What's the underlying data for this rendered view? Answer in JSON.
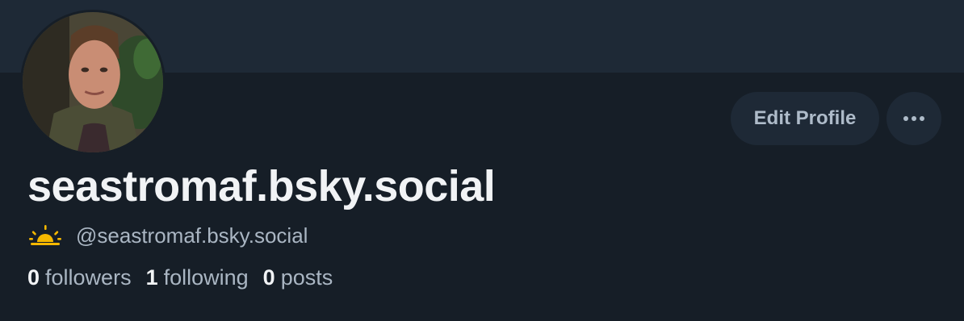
{
  "profile": {
    "display_name": "seastromaf.bsky.social",
    "handle": "@seastromaf.bsky.social",
    "avatar_icon": "user-photo",
    "emoji_icon": "sunrise-icon"
  },
  "actions": {
    "edit_profile_label": "Edit Profile",
    "more_icon": "ellipsis-icon"
  },
  "stats": {
    "followers_count": "0",
    "followers_label": "followers",
    "following_count": "1",
    "following_label": "following",
    "posts_count": "0",
    "posts_label": "posts"
  },
  "colors": {
    "background": "#161e27",
    "banner": "#1e2936",
    "button_bg": "#1e2936",
    "text_primary": "#f1f3f5",
    "text_secondary": "#aab6c3",
    "sun_yellow": "#f5b800"
  }
}
